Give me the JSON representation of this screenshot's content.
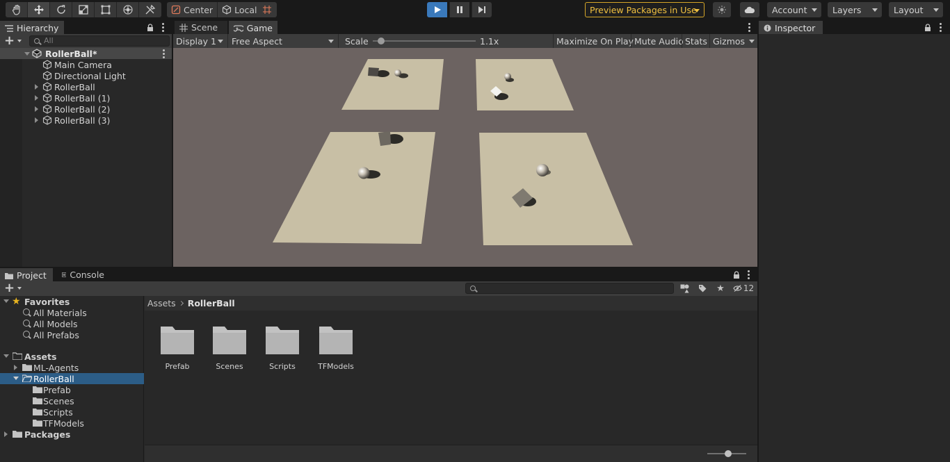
{
  "toolbar": {
    "tools": [
      "hand-tool",
      "move-tool",
      "rotate-tool",
      "scale-tool",
      "rect-tool",
      "transform-tool",
      "custom-tool"
    ],
    "pivot_label": "Center",
    "space_label": "Local",
    "preview_packages_label": "Preview Packages in Use",
    "account_label": "Account",
    "layers_label": "Layers",
    "layout_label": "Layout"
  },
  "hierarchy": {
    "tab_label": "Hierarchy",
    "search_placeholder": "All",
    "scene_name": "RollerBall*",
    "items": [
      {
        "label": "Main Camera"
      },
      {
        "label": "Directional Light"
      },
      {
        "label": "RollerBall"
      },
      {
        "label": "RollerBall (1)"
      },
      {
        "label": "RollerBall (2)"
      },
      {
        "label": "RollerBall (3)"
      }
    ]
  },
  "gameview": {
    "tabs": [
      {
        "label": "Scene"
      },
      {
        "label": "Game"
      }
    ],
    "display_label": "Display 1",
    "aspect_label": "Free Aspect",
    "scale_label": "Scale",
    "scale_value": "1.1x",
    "scale_fraction": 0.05,
    "maximize_label": "Maximize On Play",
    "mute_label": "Mute Audio",
    "stats_label": "Stats",
    "gizmos_label": "Gizmos"
  },
  "inspector": {
    "tab_label": "Inspector"
  },
  "project": {
    "tabs": [
      {
        "label": "Project"
      },
      {
        "label": "Console"
      }
    ],
    "hidden_count": "12",
    "favorites_label": "Favorites",
    "favorites": [
      {
        "label": "All Materials"
      },
      {
        "label": "All Models"
      },
      {
        "label": "All Prefabs"
      }
    ],
    "assets_label": "Assets",
    "assets_children": [
      {
        "label": "ML-Agents"
      },
      {
        "label": "RollerBall"
      }
    ],
    "rollerball_children": [
      {
        "label": "Prefab"
      },
      {
        "label": "Scenes"
      },
      {
        "label": "Scripts"
      },
      {
        "label": "TFModels"
      }
    ],
    "packages_label": "Packages",
    "breadcrumb": [
      "Assets",
      "RollerBall"
    ],
    "content_items": [
      {
        "label": "Prefab"
      },
      {
        "label": "Scenes"
      },
      {
        "label": "Scripts"
      },
      {
        "label": "TFModels"
      }
    ],
    "thumbnail_size_fraction": 0.55
  },
  "colors": {
    "accent_blue": "#3a79bb",
    "selection": "#2c5d87",
    "preview_warning": "#d6a628",
    "game_background": "#6c6361",
    "floor": "#c8bfa5"
  }
}
